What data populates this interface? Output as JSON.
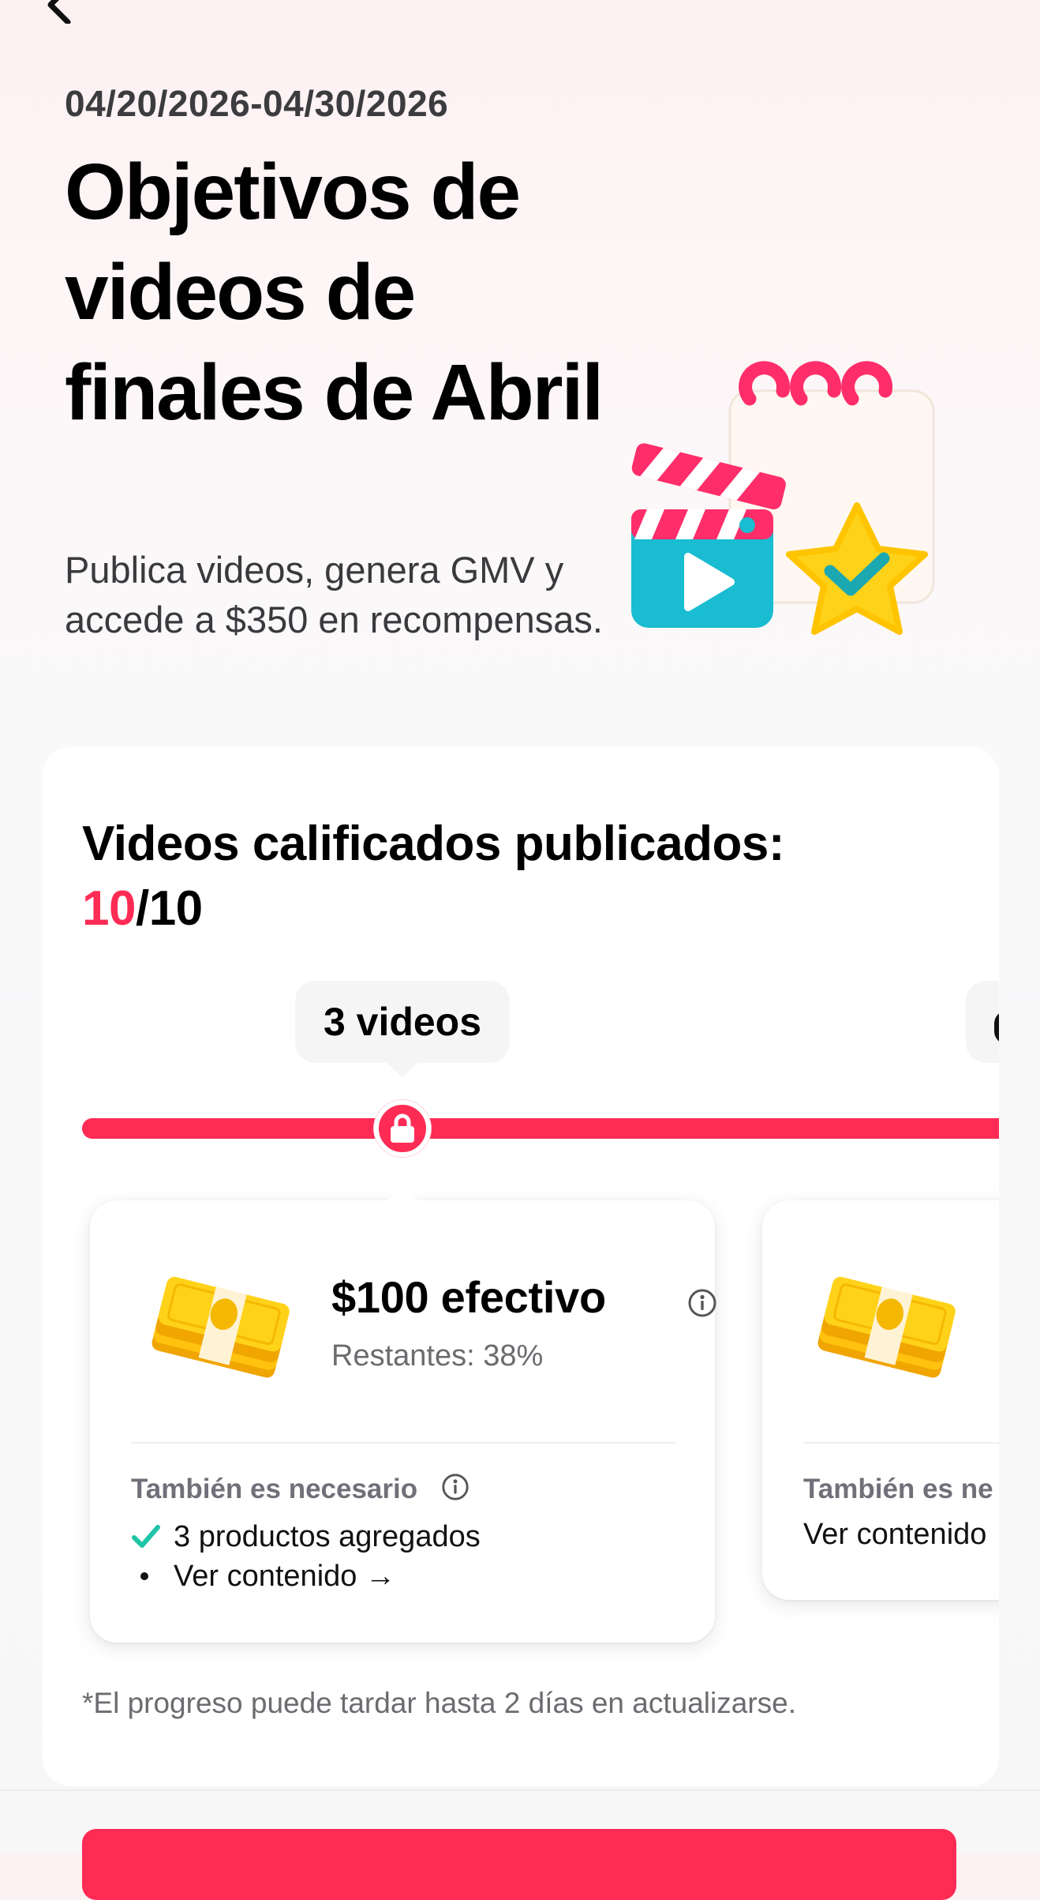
{
  "header": {
    "date_range": "04/20/2026-04/30/2026",
    "title": "Objetivos de videos de finales de Abril",
    "subtitle": "Publica videos, genera GMV y accede a $350 en recompensas."
  },
  "progress": {
    "label": "Videos calificados publicados:",
    "completed": "10",
    "total": "/10",
    "completed_value": 10,
    "total_value": 10
  },
  "milestones": [
    {
      "label": "3 videos",
      "locked": true,
      "reward": {
        "title": "$100 efectivo",
        "remaining": "Restantes: 38%",
        "requirements_heading": "También es necesario",
        "requirements": [
          {
            "text": "3 productos agregados",
            "status": "done"
          },
          {
            "text": "Ver contenido →",
            "status": "pending"
          }
        ]
      }
    },
    {
      "reward": {
        "requirements_heading": "También es ne",
        "requirements": [
          {
            "text": "Ver contenido",
            "status": "pending"
          }
        ]
      }
    }
  ],
  "footer_note": "*El progreso puede tardar hasta 2 días en actualizarse.",
  "colors": {
    "accent": "#fe2c55",
    "check": "#1ec4a8",
    "muted_text": "#6b6b70"
  },
  "icons": {
    "back": "chevron-left-icon",
    "lock": "lock-icon",
    "info": "info-icon",
    "check": "check-icon",
    "cash": "cash-stack-icon"
  }
}
